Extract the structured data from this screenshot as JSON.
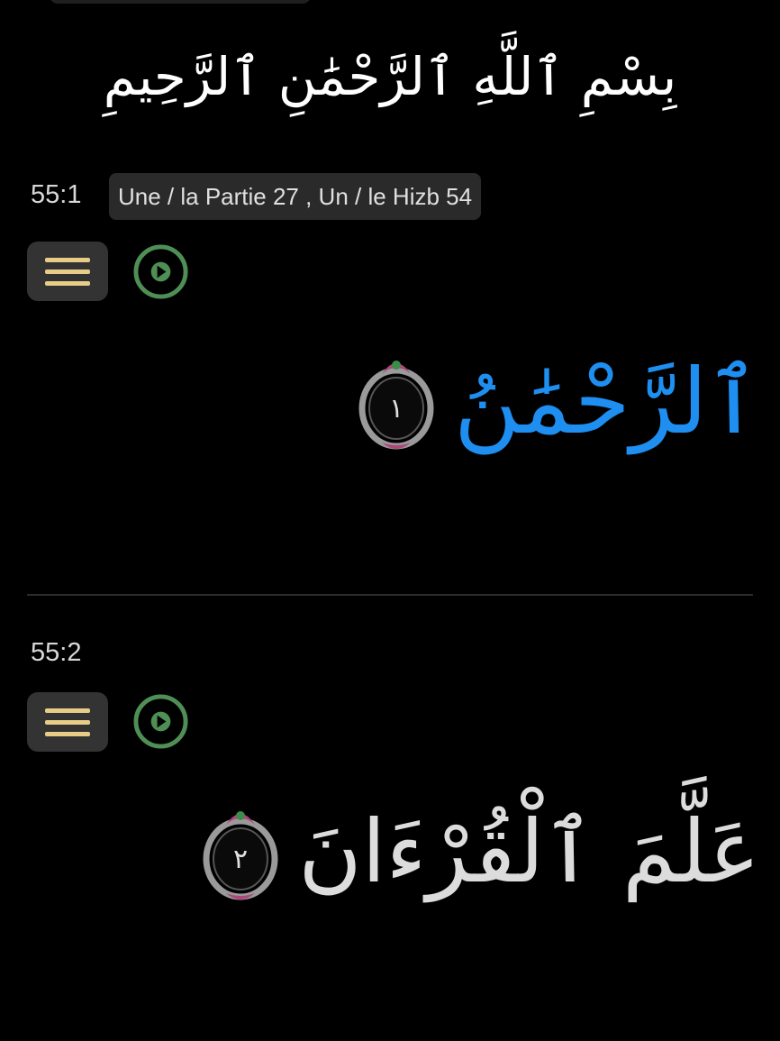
{
  "basmala": "بِسْمِ ٱللَّهِ ٱلرَّحْمَٰنِ ٱلرَّحِيمِ",
  "colors": {
    "background": "#000000",
    "highlight_ayah": "#1e8ff0",
    "normal_ayah": "#dcdcdc",
    "menu_icon": "#e7cd86",
    "play_icon": "#4f8f55",
    "marker_accent": "#b0457a"
  },
  "verses": [
    {
      "number": "55:1",
      "badge": "Une / la Partie 27 , Un / le Hizb 54",
      "text": "ٱلرَّحْمَٰنُ",
      "marker": "١",
      "menu_icon": "hamburger-icon",
      "play_icon": "play-icon",
      "highlighted": true
    },
    {
      "number": "55:2",
      "badge": "",
      "text": "عَلَّمَ ٱلْقُرْءَانَ",
      "marker": "٢",
      "menu_icon": "hamburger-icon",
      "play_icon": "play-icon",
      "highlighted": false
    }
  ]
}
